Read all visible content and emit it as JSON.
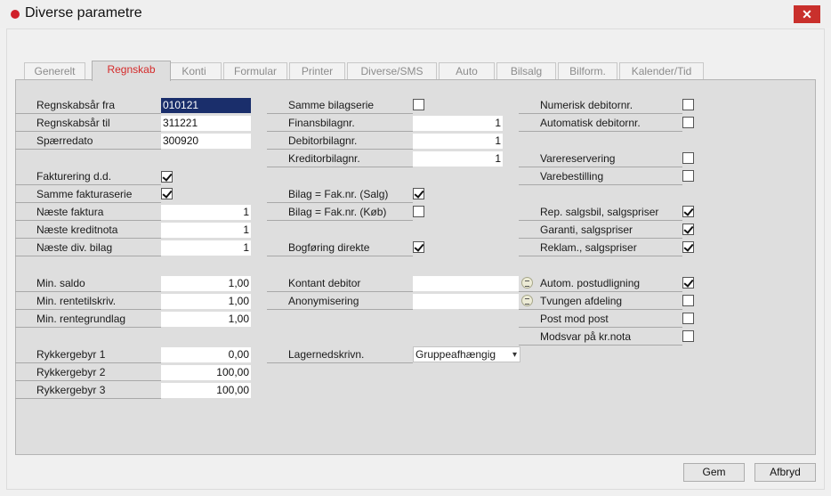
{
  "window": {
    "title": "Diverse parametre",
    "close_glyph": "✕"
  },
  "tabs": [
    {
      "label": "Generelt",
      "active": false
    },
    {
      "label": "Regnskab",
      "active": true
    },
    {
      "label": "Konti",
      "active": false
    },
    {
      "label": "Formular",
      "active": false
    },
    {
      "label": "Printer",
      "active": false
    },
    {
      "label": "Diverse/SMS",
      "active": false
    },
    {
      "label": "Auto",
      "active": false
    },
    {
      "label": "Bilsalg",
      "active": false
    },
    {
      "label": "Bilform.",
      "active": false
    },
    {
      "label": "Kalender/Tid",
      "active": false
    }
  ],
  "col1": {
    "regnskabsaar_fra": {
      "label": "Regnskabsår fra",
      "value": "010121"
    },
    "regnskabsaar_til": {
      "label": "Regnskabsår til",
      "value": "311221"
    },
    "spaerredato": {
      "label": "Spærredato",
      "value": "300920"
    },
    "fakturering_dd": {
      "label": "Fakturering d.d.",
      "checked": true
    },
    "samme_fakturaserie": {
      "label": "Samme fakturaserie",
      "checked": true
    },
    "naeste_faktura": {
      "label": "Næste faktura",
      "value": "1"
    },
    "naeste_kreditnota": {
      "label": "Næste kreditnota",
      "value": "1"
    },
    "naeste_div_bilag": {
      "label": "Næste div. bilag",
      "value": "1"
    },
    "min_saldo": {
      "label": "Min. saldo",
      "value": "1,00"
    },
    "min_rentetilskriv": {
      "label": "Min. rentetilskriv.",
      "value": "1,00"
    },
    "min_rentegrundlag": {
      "label": "Min. rentegrundlag",
      "value": "1,00"
    },
    "rykkergebyr_1": {
      "label": "Rykkergebyr 1",
      "value": "0,00"
    },
    "rykkergebyr_2": {
      "label": "Rykkergebyr 2",
      "value": "100,00"
    },
    "rykkergebyr_3": {
      "label": "Rykkergebyr 3",
      "value": "100,00"
    }
  },
  "col2": {
    "samme_bilagserie": {
      "label": "Samme bilagserie",
      "checked": false
    },
    "finansbilagnr": {
      "label": "Finansbilagnr.",
      "value": "1"
    },
    "debitorbilagnr": {
      "label": "Debitorbilagnr.",
      "value": "1"
    },
    "kreditorbilagnr": {
      "label": "Kreditorbilagnr.",
      "value": "1"
    },
    "bilag_fak_salg": {
      "label": "Bilag = Fak.nr. (Salg)",
      "checked": true
    },
    "bilag_fak_koeb": {
      "label": "Bilag = Fak.nr. (Køb)",
      "checked": false
    },
    "bogfoering_direkte": {
      "label": "Bogføring direkte",
      "checked": true
    },
    "kontant_debitor": {
      "label": "Kontant debitor",
      "value": ""
    },
    "anonymisering": {
      "label": "Anonymisering",
      "value": ""
    },
    "lagernedskrivn": {
      "label": "Lagernedskrivn.",
      "value": "Gruppeafhængig",
      "arrow": "▾"
    }
  },
  "col3": {
    "numerisk_debitornr": {
      "label": "Numerisk debitornr.",
      "checked": false
    },
    "automatisk_debitornr": {
      "label": "Automatisk debitornr.",
      "checked": false
    },
    "varereservering": {
      "label": "Varereservering",
      "checked": false
    },
    "varebestilling": {
      "label": "Varebestilling",
      "checked": false
    },
    "rep_salgsbil": {
      "label": "Rep. salgsbil, salgspriser",
      "checked": true
    },
    "garanti_salgspriser": {
      "label": "Garanti, salgspriser",
      "checked": true
    },
    "reklam_salgspriser": {
      "label": "Reklam., salgspriser",
      "checked": true
    },
    "autom_postudligning": {
      "label": "Autom. postudligning",
      "checked": true
    },
    "tvungen_afdeling": {
      "label": "Tvungen afdeling",
      "checked": false
    },
    "post_mod_post": {
      "label": "Post mod post",
      "checked": false
    },
    "modsvar_kr_nota": {
      "label": "Modsvar på kr.nota",
      "checked": false
    }
  },
  "buttons": {
    "gem": "Gem",
    "afbryd": "Afbryd"
  }
}
